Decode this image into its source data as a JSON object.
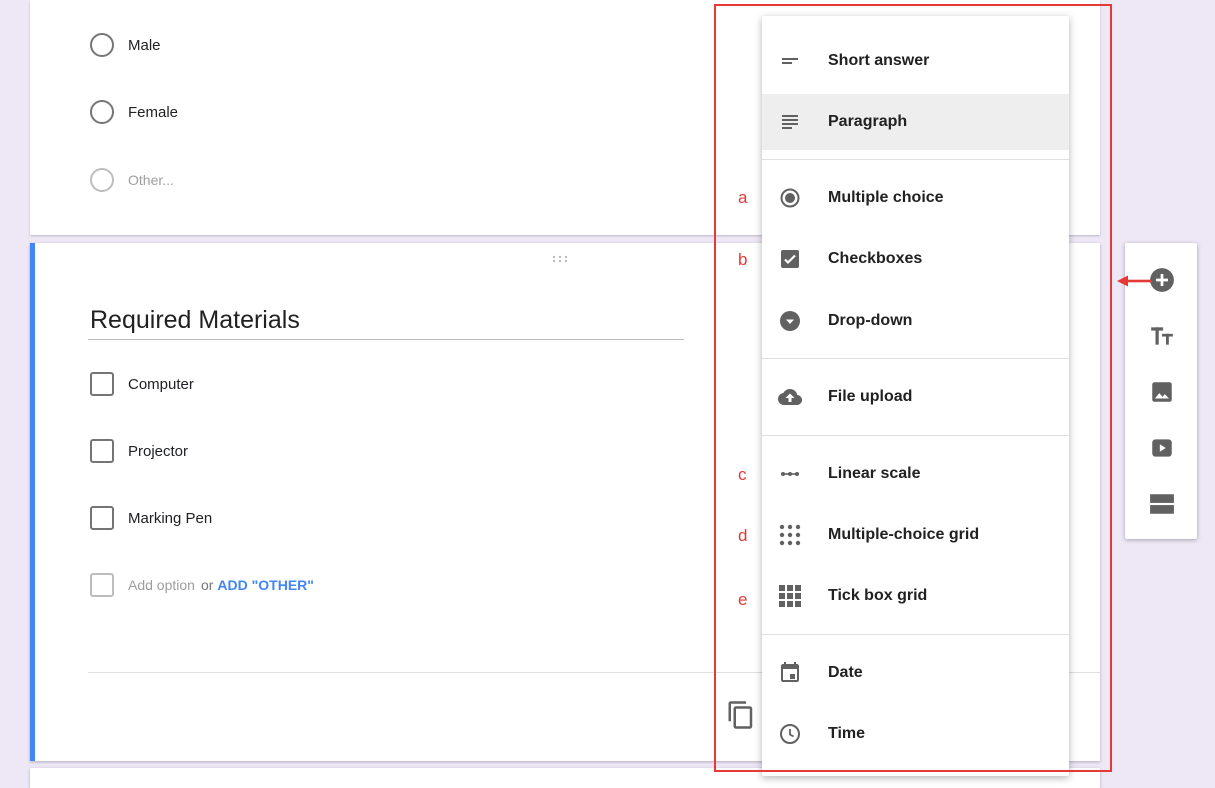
{
  "previous_question": {
    "options": [
      {
        "label": "Male"
      },
      {
        "label": "Female"
      },
      {
        "label": "Other..."
      }
    ]
  },
  "question": {
    "title": "Required Materials",
    "options": [
      {
        "label": "Computer"
      },
      {
        "label": "Projector"
      },
      {
        "label": "Marking Pen"
      }
    ],
    "add_option": "Add option",
    "or_text": "or",
    "add_other": "ADD \"OTHER\""
  },
  "type_menu": {
    "items": [
      {
        "label": "Short answer",
        "icon": "short-answer-icon"
      },
      {
        "label": "Paragraph",
        "icon": "paragraph-icon",
        "selected": true
      },
      {
        "label": "Multiple choice",
        "icon": "radio-button-icon"
      },
      {
        "label": "Checkboxes",
        "icon": "checkbox-icon"
      },
      {
        "label": "Drop-down",
        "icon": "dropdown-icon"
      },
      {
        "label": "File upload",
        "icon": "cloud-upload-icon"
      },
      {
        "label": "Linear scale",
        "icon": "linear-scale-icon"
      },
      {
        "label": "Multiple-choice grid",
        "icon": "grid-dots-icon"
      },
      {
        "label": "Tick box grid",
        "icon": "grid-squares-icon"
      },
      {
        "label": "Date",
        "icon": "calendar-icon"
      },
      {
        "label": "Time",
        "icon": "clock-icon"
      }
    ]
  },
  "annotations": {
    "letters": [
      "a",
      "b",
      "c",
      "d",
      "e"
    ],
    "color": "#e53935"
  },
  "sidebar": {
    "buttons": [
      {
        "icon": "add-question-icon"
      },
      {
        "icon": "title-text-icon"
      },
      {
        "icon": "image-icon"
      },
      {
        "icon": "video-icon"
      },
      {
        "icon": "section-icon"
      }
    ]
  },
  "colors": {
    "accent": "#4285f4",
    "background": "#ede7f6",
    "icon": "#616161"
  }
}
